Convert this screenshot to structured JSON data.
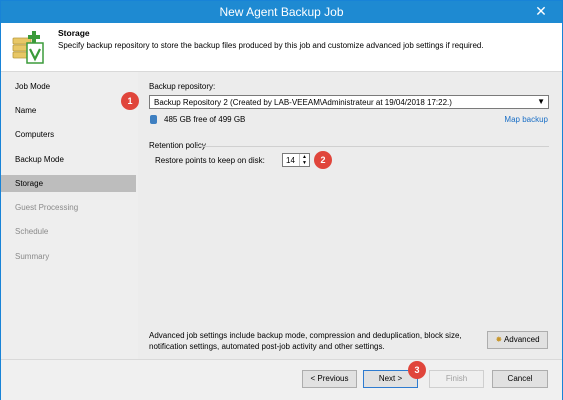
{
  "window": {
    "title": "New Agent Backup Job",
    "close_glyph": "✕"
  },
  "header": {
    "title": "Storage",
    "description": "Specify backup repository to store the backup files produced by this job and customize advanced job settings if required."
  },
  "sidebar": {
    "items": [
      {
        "label": "Job Mode"
      },
      {
        "label": "Name"
      },
      {
        "label": "Computers"
      },
      {
        "label": "Backup Mode"
      },
      {
        "label": "Storage"
      },
      {
        "label": "Guest Processing"
      },
      {
        "label": "Schedule"
      },
      {
        "label": "Summary"
      }
    ]
  },
  "storage": {
    "repo_label": "Backup repository:",
    "repo_value": "Backup Repository 2 (Created by LAB-VEEAM\\Administrateur at 19/04/2018 17:22.)",
    "free_space": "485 GB free of 499 GB",
    "map_link": "Map backup",
    "retention_title": "Retention policy",
    "restore_points_label": "Restore points to keep on disk:",
    "restore_points_value": "14",
    "advanced_text": "Advanced job settings include backup mode, compression and deduplication, block size, notification settings, automated post-job activity and other settings.",
    "advanced_button": "Advanced"
  },
  "markers": {
    "m1": "1",
    "m2": "2",
    "m3": "3"
  },
  "footer": {
    "previous": "< Previous",
    "next": "Next >",
    "finish": "Finish",
    "cancel": "Cancel"
  },
  "colors": {
    "titlebar": "#1e8ad2",
    "marker": "#e0453b",
    "link": "#1a6fc6",
    "sidebar_active": "#bdbdbd"
  }
}
